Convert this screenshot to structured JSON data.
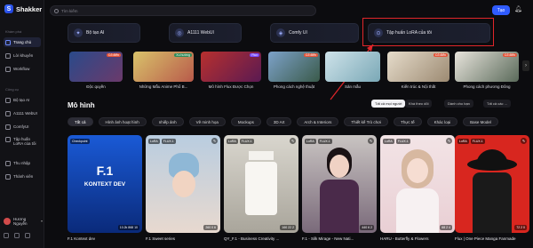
{
  "app": {
    "name": "Shakker",
    "brand_color": "#2f5bff",
    "highlight_color": "#e0262a"
  },
  "sidebar": {
    "section_main": "Khám phá",
    "section_tools": "Công cụ",
    "items_main": [
      {
        "label": "Trang chủ",
        "icon": "home-icon",
        "active": true
      },
      {
        "label": "Lời khuyên",
        "icon": "bulb-icon"
      },
      {
        "label": "Workflow",
        "icon": "workflow-icon"
      }
    ],
    "items_tools": [
      {
        "label": "Bộ tạo AI",
        "icon": "sparkle-icon"
      },
      {
        "label": "A1111 WebUI",
        "icon": "webui-icon"
      },
      {
        "label": "ComfyUI",
        "icon": "comfy-icon"
      },
      {
        "label": "Tập huấn LoRA của tôi",
        "icon": "lora-icon"
      }
    ],
    "items_other": [
      {
        "label": "Thu nhập",
        "icon": "wallet-icon"
      },
      {
        "label": "Thành viên",
        "icon": "member-icon"
      }
    ],
    "user_name": "Hương Nguyễn"
  },
  "header": {
    "search_placeholder": "Tìm kiếm",
    "create_label": "Tạo"
  },
  "quick_actions": [
    {
      "label": "Bộ tạo AI",
      "icon": "sparkle-icon"
    },
    {
      "label": "A1111 WebUI",
      "icon": "webui-icon"
    },
    {
      "label": "Comfy UI",
      "icon": "comfy-icon"
    },
    {
      "label": "Tập huấn LoRA của tôi",
      "icon": "lora-icon"
    }
  ],
  "categories": [
    {
      "label": "Độc quyền",
      "badge": "Cổ điển"
    },
    {
      "label": "Những Mẫu Anime Phổ B...",
      "badge": "Xu hướng"
    },
    {
      "label": "Mô hình Flux Được Chọn",
      "badge": "Flux"
    },
    {
      "label": "Phong cách nghệ thuật",
      "badge": "Cổ điển"
    },
    {
      "label": "Sản mẫu",
      "badge": ""
    },
    {
      "label": "Kiến trúc & Nội thất",
      "badge": "Cổ điển"
    },
    {
      "label": "Phong cách phương Đông",
      "badge": "Cổ điển"
    }
  ],
  "models_section": {
    "title": "Mô hình",
    "sort_options": [
      "Tất cả mọi người",
      "Khá theo dõi",
      "Dành cho bạn",
      "Tất cả các ..."
    ],
    "filters": [
      "Tất cả",
      "Hình ảnh hoạt hình",
      "nhiếp ảnh",
      "Vẽ minh họa",
      "Mockups",
      "3D Art",
      "Arch & Interiors",
      "Thiết kế Trò chơi",
      "Thực tế",
      "Khác loại",
      "Base Model"
    ]
  },
  "models": [
    {
      "title": "F.1 Kontext dev",
      "tags": [
        "Checkpoint"
      ],
      "cover_line1": "F.1",
      "cover_line2": "KONTEXT DEV",
      "stats": "10.2k  868  10"
    },
    {
      "title": "F.1 Sweet series",
      "tags": [
        "LoRA",
        "FLUX.1"
      ],
      "stats": "260  0  6"
    },
    {
      "title": "QY_F.1 - Business Creativity ...",
      "tags": [
        "LoRA",
        "FLUX.1"
      ],
      "stats": "160  22  2"
    },
    {
      "title": "F.1 - Silk Mirage - New Nati...",
      "tags": [
        "LoRA",
        "FLUX.1"
      ],
      "stats": "440  6  2"
    },
    {
      "title": "HARU - Butterfly & Flowers",
      "tags": [
        "LoRA",
        "FLUX.1"
      ],
      "stats": "68  2  4"
    },
    {
      "title": "Flux | One Piece Manga Fanmade",
      "tags": [
        "LoRA",
        "FLUX.1"
      ],
      "stats": "72  2  0"
    }
  ]
}
